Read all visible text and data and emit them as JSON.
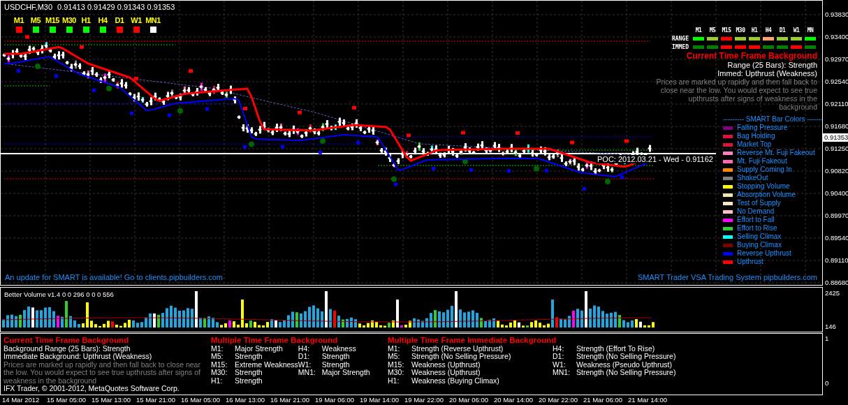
{
  "chart": {
    "symbol": "USDCHF,M30",
    "quote": "0.91413 0.91429 0.91343 0.91353",
    "timeframes": [
      {
        "label": "M1",
        "color": "#ff0000"
      },
      {
        "label": "M5",
        "color": "#00ff00"
      },
      {
        "label": "M15",
        "color": "#00ff00"
      },
      {
        "label": "M30",
        "color": "#00ff00"
      },
      {
        "label": "H1",
        "color": "#00ff00"
      },
      {
        "label": "H4",
        "color": "#00ff00"
      },
      {
        "label": "D1",
        "color": "#ff0000"
      },
      {
        "label": "W1",
        "color": "#ff0000"
      },
      {
        "label": "MN1",
        "color": "#ffffff"
      }
    ],
    "signal_grid": {
      "columns": [
        "M1",
        "M5",
        "M15",
        "M30",
        "H1",
        "H4",
        "D1",
        "W1",
        "MN"
      ],
      "rows": [
        {
          "label": "RANGE",
          "cells": [
            {
              "color": "#00ff00"
            },
            {
              "color": "#9acd32"
            },
            {
              "color": "#ff0000"
            },
            {
              "color": "#9acd32"
            },
            {
              "color": "#9acd32"
            },
            {
              "color": "#ffa07a"
            },
            {
              "color": "#9acd32"
            },
            {
              "color": "#9acd32"
            },
            {
              "color": "#00ff00"
            }
          ]
        },
        {
          "label": "IMMED",
          "cells": [
            {
              "color": "#008000"
            },
            {
              "color": "#008000"
            },
            {
              "color": "#ff0000"
            },
            {
              "color": "#ff0000"
            },
            {
              "color": "#ff0000"
            },
            {
              "color": "#008000"
            },
            {
              "color": "#008000"
            },
            {
              "color": "#ff0000"
            },
            {
              "color": "#008000"
            }
          ]
        }
      ]
    },
    "background": {
      "title": "Current Time Frame Background",
      "range": "Range (25 Bars): Strength",
      "immed": "Immed: Upthrust (Weakness)",
      "description": "Prices are marked up rapidly and then fall back to close near the low. You would expect to see true upthrusts after signs of weakness in the background"
    },
    "legend": {
      "title": "--------- SMART Bar Colors -------",
      "items": [
        {
          "label": "Falling Pressure",
          "color": "#800080"
        },
        {
          "label": "Bag Holding",
          "color": "#dc143c"
        },
        {
          "label": "Market Top",
          "color": "#dc143c"
        },
        {
          "label": "Reverse Mt. Fuji Fakeout",
          "color": "#ff80c0"
        },
        {
          "label": "Mt. Fuji Fakeout",
          "color": "#ff69b4"
        },
        {
          "label": "Supply Coming In",
          "color": "#ff8c00"
        },
        {
          "label": "ShakeOut",
          "color": "#808080"
        },
        {
          "label": "Stopping Volume",
          "color": "#ffff00"
        },
        {
          "label": "Absorption Volume",
          "color": "#eee8aa"
        },
        {
          "label": "Test of Supply",
          "color": "#ffe4c4"
        },
        {
          "label": "No Demand",
          "color": "#ffc0cb"
        },
        {
          "label": "Effort to Fall",
          "color": "#ff00ff"
        },
        {
          "label": "Effort to Rise",
          "color": "#32cd32"
        },
        {
          "label": "Selling Climax",
          "color": "#00ffff"
        },
        {
          "label": "Buying Climax",
          "color": "#800000"
        },
        {
          "label": "Reverse Upthrust",
          "color": "#0000ff"
        },
        {
          "label": "Upthrust",
          "color": "#ff0000"
        }
      ]
    },
    "poc_label": "POC: 2012.03.21 - Wed - 0.91162",
    "update_notice": "An update for SMART is available! Go to clients.pipbuilders.com",
    "branding": "SMART Trader VSA Trading System pipbuilders.com"
  },
  "price_axis": {
    "labels": [
      "0.93830",
      "0.93400",
      "0.92970",
      "0.92540",
      "0.92110",
      "0.91680",
      "0.91250",
      "0.90820",
      "0.90400",
      "0.89970",
      "0.89540",
      "0.89110",
      "0.88680"
    ],
    "current": "0.91353"
  },
  "volume": {
    "title": "Better Volume v1.4 0 0 296 0 0 0 556",
    "axis": [
      "2425",
      "146"
    ]
  },
  "info": {
    "current": {
      "title": "Current Time Frame Background",
      "lines": [
        "Background Range (25 Bars): Strength",
        "Immediate Background: Upthrust (Weakness)"
      ],
      "description": "Prices are marked up rapidly and then fall back to close near the low. You would expect to see true upthrusts after signs of weakness in the background",
      "copyright": "IFX Trader, © 2001-2012, MetaQuotes Software Corp."
    },
    "mtf_background": {
      "title": "Multiple Time Frame Background",
      "items": [
        {
          "timeframe": "M1:",
          "value": "Major Strength"
        },
        {
          "timeframe": "M5:",
          "value": "Strength"
        },
        {
          "timeframe": "M15:",
          "value": "Extreme Weakness"
        },
        {
          "timeframe": "M30:",
          "value": "Strength"
        },
        {
          "timeframe": "H1:",
          "value": "Strength"
        },
        {
          "timeframe": "H4:",
          "value": "Weakness"
        },
        {
          "timeframe": "D1:",
          "value": "Strength"
        },
        {
          "timeframe": "W1:",
          "value": "Strength"
        },
        {
          "timeframe": "MN1:",
          "value": "Major Strength"
        }
      ]
    },
    "mtf_immediate": {
      "title": "Multiple Time Frame Immediate Background",
      "items": [
        {
          "timeframe": "M1:",
          "value": "Strength (Reverse Upthrust)"
        },
        {
          "timeframe": "M5:",
          "value": "Strength (No Selling Pressure)"
        },
        {
          "timeframe": "M15:",
          "value": "Weakness (Upthrust)"
        },
        {
          "timeframe": "M30:",
          "value": "Weakness (Upthrust)"
        },
        {
          "timeframe": "H1:",
          "value": "Weakness (Buying Climax)"
        },
        {
          "timeframe": "H4:",
          "value": "Strength (Effort To Rise)"
        },
        {
          "timeframe": "D1:",
          "value": "Strength (No Selling Pressure)"
        },
        {
          "timeframe": "W1:",
          "value": "Weakness (Pseudo Upthrust)"
        },
        {
          "timeframe": "MN1:",
          "value": "Strength (No Selling Pressure)"
        }
      ]
    },
    "axis": [
      "1",
      "0"
    ]
  },
  "time_axis": [
    "14 Mar 2012",
    "15 Mar 05:00",
    "15 Mar 13:00",
    "15 Mar 21:00",
    "16 Mar 05:00",
    "16 Mar 13:00",
    "16 Mar 21:00",
    "19 Mar 06:00",
    "19 Mar 14:00",
    "19 Mar 22:00",
    "20 Mar 06:00",
    "20 Mar 14:00",
    "20 Mar 22:00",
    "21 Mar 06:00",
    "21 Mar 14:00"
  ]
}
